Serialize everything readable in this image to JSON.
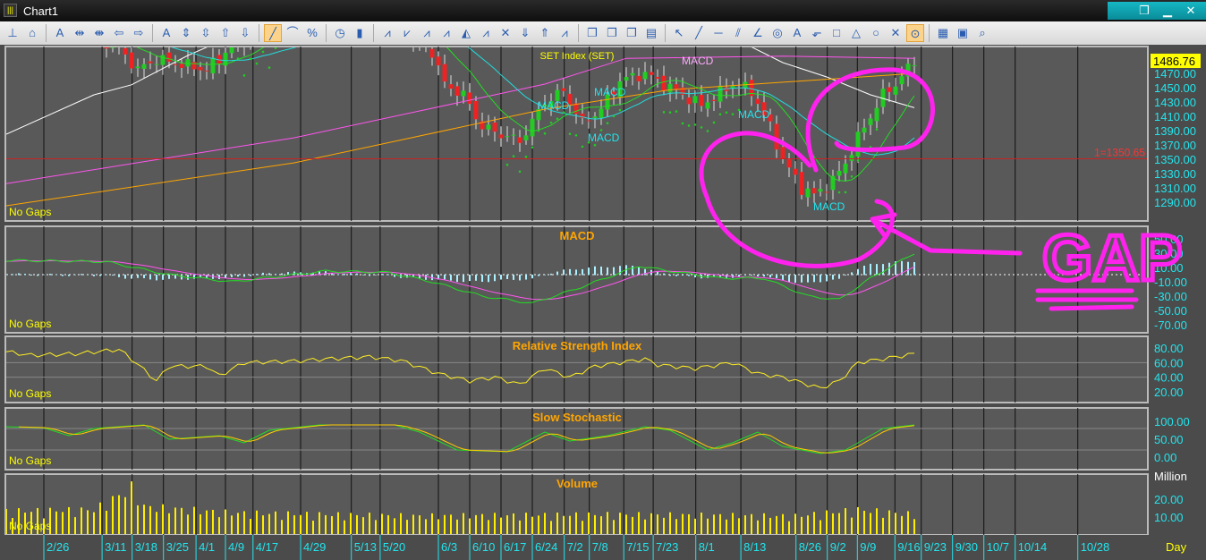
{
  "window": {
    "title": "Chart1",
    "icon": "chart-app-icon",
    "buttons": [
      "restore-icon",
      "minimize-icon",
      "close-icon"
    ]
  },
  "toolbar": {
    "icons": [
      "pin-icon",
      "home-icon",
      "text-axis-icon",
      "expand-horizontal-icon",
      "compress-horizontal-icon",
      "arrow-left-icon",
      "arrow-right-icon",
      "vertical-text-icon",
      "expand-vertical-icon",
      "compress-vertical-icon",
      "arrow-up-icon",
      "arrow-down-icon",
      "linear-scale-icon",
      "log-scale-icon",
      "percent-icon",
      "timer-icon",
      "candlestick-icon",
      "add-indicator-icon",
      "add-study-icon",
      "add-overlay-icon",
      "add-panel-icon",
      "paint-icon",
      "remove-indicator-icon",
      "delete-icon",
      "move-down-icon",
      "move-up-icon",
      "remove-panel-icon",
      "copy-icon",
      "paste-icon",
      "duplicate-icon",
      "clipboard-icon",
      "cursor-icon",
      "line-icon",
      "horizontal-line-icon",
      "parallel-lines-icon",
      "fan-icon",
      "circle-tool-icon",
      "text-tool-icon",
      "callout-icon",
      "rectangle-icon",
      "triangle-icon",
      "ellipse-icon",
      "delete-drawing-icon",
      "magnet-icon",
      "grid-icon",
      "properties-icon",
      "print-preview-icon"
    ],
    "glyphs": [
      "⊥",
      "⌂",
      "A",
      "⇹",
      "⇼",
      "⇦",
      "⇨",
      "A",
      "⇕",
      "⇳",
      "⇧",
      "⇩",
      "╱",
      "⌒",
      "%",
      "◷",
      "▮",
      "⩘",
      "⩗",
      "⩘",
      "⩘",
      "◭",
      "⩘",
      "✕",
      "⇓",
      "⇑",
      "⩘",
      "❐",
      "❐",
      "❐",
      "▤",
      "↖",
      "╱",
      "─",
      "⫽",
      "∠",
      "◎",
      "A",
      "⬐",
      "□",
      "△",
      "○",
      "✕",
      "⊙",
      "▦",
      "▣",
      "⌕"
    ]
  },
  "panels": {
    "price": {
      "title": "SET Index (SET)",
      "no_gaps": "No Gaps",
      "last_price": "1486.76",
      "axis": [
        "1470.00",
        "1450.00",
        "1430.00",
        "1410.00",
        "1390.00",
        "1370.00",
        "1350.00",
        "1330.00",
        "1310.00",
        "1290.00"
      ],
      "hline_label": "1=1350.65",
      "hline_value": 1350.65,
      "signal_label": "MACD"
    },
    "macd": {
      "title": "MACD",
      "no_gaps": "No Gaps",
      "axis": [
        "50.00",
        "30.00",
        "10.00",
        "-10.00",
        "-30.00",
        "-50.00",
        "-70.00"
      ]
    },
    "rsi": {
      "title": "Relative Strength Index",
      "no_gaps": "No Gaps",
      "axis": [
        "80.00",
        "60.00",
        "40.00",
        "20.00"
      ]
    },
    "stoch": {
      "title": "Slow Stochastic",
      "no_gaps": "No Gaps",
      "axis": [
        "100.00",
        "50.00",
        "0.00"
      ]
    },
    "volume": {
      "title": "Volume",
      "no_gaps": "No Gaps",
      "axis": [
        "Million",
        "20.00",
        "10.00"
      ]
    }
  },
  "annotation": {
    "text": "GAP",
    "color": "#ff22ee"
  },
  "date_axis": {
    "unit_label": "Day",
    "labels": [
      [
        "2/26",
        0
      ],
      [
        "3/11",
        9.3
      ],
      [
        "3/18",
        14.1
      ],
      [
        "3/25",
        19.1
      ],
      [
        "4/1",
        24.3
      ],
      [
        "4/9",
        29
      ],
      [
        "4/17",
        33.4
      ],
      [
        "4/29",
        41
      ],
      [
        "5/13",
        49.1
      ],
      [
        "5/20",
        53.7
      ],
      [
        "6/3",
        63
      ],
      [
        "6/10",
        68
      ],
      [
        "6/17",
        73
      ],
      [
        "6/24",
        78
      ],
      [
        "7/2",
        83.1
      ],
      [
        "7/8",
        87.1
      ],
      [
        "7/15",
        92.6
      ],
      [
        "7/23",
        97.3
      ],
      [
        "8/1",
        104.1
      ],
      [
        "8/13",
        111.3
      ],
      [
        "8/26",
        120.1
      ],
      [
        "9/2",
        125.1
      ],
      [
        "9/9",
        129.9
      ],
      [
        "9/16",
        135.9
      ],
      [
        "9/23",
        140.1
      ],
      [
        "9/30",
        145.1
      ],
      [
        "10/7",
        150.1
      ],
      [
        "10/14",
        155.1
      ],
      [
        "10/28",
        165.1
      ]
    ]
  },
  "colors": {
    "bg": "#4b4b4b",
    "up": "#22cc22",
    "down": "#ee2222",
    "axis_text": "#22e5ee",
    "title": "#ffa500",
    "no_gaps": "#ffff00"
  },
  "chart_data": {
    "type": "candlestick+indicators",
    "x_unit": "trading day index (0 = 2/26)",
    "price_close_keypoints": [
      [
        -6,
        1540
      ],
      [
        5,
        1530
      ],
      [
        12,
        1505
      ],
      [
        15,
        1475
      ],
      [
        18,
        1490
      ],
      [
        26,
        1475
      ],
      [
        28,
        1490
      ],
      [
        30,
        1510
      ],
      [
        40,
        1540
      ],
      [
        55,
        1540
      ],
      [
        62,
        1500
      ],
      [
        64,
        1455
      ],
      [
        67,
        1440
      ],
      [
        70,
        1395
      ],
      [
        76,
        1375
      ],
      [
        80,
        1430
      ],
      [
        83,
        1445
      ],
      [
        86,
        1400
      ],
      [
        89,
        1420
      ],
      [
        92,
        1460
      ],
      [
        96,
        1470
      ],
      [
        99,
        1455
      ],
      [
        102,
        1440
      ],
      [
        105,
        1425
      ],
      [
        110,
        1455
      ],
      [
        113,
        1445
      ],
      [
        116,
        1395
      ],
      [
        118,
        1350
      ],
      [
        121,
        1310
      ],
      [
        123,
        1300
      ],
      [
        126,
        1320
      ],
      [
        128,
        1345
      ],
      [
        130,
        1380
      ],
      [
        132,
        1410
      ],
      [
        134,
        1440
      ],
      [
        136,
        1455
      ],
      [
        139,
        1487
      ]
    ],
    "ma_white": [
      [
        -6,
        1385
      ],
      [
        8,
        1440
      ],
      [
        14,
        1454
      ],
      [
        23,
        1495
      ],
      [
        40,
        1560
      ],
      [
        110,
        1520
      ],
      [
        118,
        1485
      ],
      [
        125,
        1465
      ],
      [
        132,
        1440
      ],
      [
        139,
        1422
      ]
    ],
    "ma_pink": [
      [
        -6,
        1316
      ],
      [
        40,
        1380
      ],
      [
        80,
        1455
      ],
      [
        93,
        1491
      ],
      [
        118,
        1494
      ],
      [
        139,
        1491
      ]
    ],
    "ma_orange": [
      [
        -6,
        1285
      ],
      [
        40,
        1345
      ],
      [
        80,
        1420
      ],
      [
        100,
        1447
      ],
      [
        139,
        1470
      ]
    ],
    "macd_keypoints": [
      [
        -6,
        20
      ],
      [
        10,
        18
      ],
      [
        20,
        0
      ],
      [
        30,
        -10
      ],
      [
        45,
        5
      ],
      [
        55,
        3
      ],
      [
        62,
        -10
      ],
      [
        70,
        -30
      ],
      [
        78,
        -40
      ],
      [
        85,
        -20
      ],
      [
        95,
        12
      ],
      [
        100,
        5
      ],
      [
        108,
        -5
      ],
      [
        115,
        -5
      ],
      [
        122,
        -30
      ],
      [
        127,
        -35
      ],
      [
        132,
        -5
      ],
      [
        139,
        30
      ]
    ],
    "rsi_keypoints": [
      [
        -6,
        75
      ],
      [
        -2,
        70
      ],
      [
        5,
        72
      ],
      [
        12,
        78
      ],
      [
        14,
        65
      ],
      [
        18,
        35
      ],
      [
        20,
        55
      ],
      [
        26,
        55
      ],
      [
        28,
        42
      ],
      [
        32,
        60
      ],
      [
        40,
        62
      ],
      [
        45,
        65
      ],
      [
        52,
        68
      ],
      [
        57,
        63
      ],
      [
        63,
        45
      ],
      [
        68,
        35
      ],
      [
        72,
        40
      ],
      [
        76,
        30
      ],
      [
        80,
        52
      ],
      [
        84,
        40
      ],
      [
        88,
        55
      ],
      [
        92,
        60
      ],
      [
        96,
        65
      ],
      [
        98,
        57
      ],
      [
        104,
        52
      ],
      [
        110,
        60
      ],
      [
        114,
        45
      ],
      [
        118,
        40
      ],
      [
        122,
        30
      ],
      [
        124,
        25
      ],
      [
        127,
        35
      ],
      [
        130,
        60
      ],
      [
        134,
        65
      ],
      [
        139,
        72
      ]
    ],
    "stoch_k_keypoints": [
      [
        -6,
        85
      ],
      [
        0,
        82
      ],
      [
        4,
        60
      ],
      [
        8,
        80
      ],
      [
        16,
        90
      ],
      [
        20,
        50
      ],
      [
        28,
        60
      ],
      [
        32,
        40
      ],
      [
        36,
        75
      ],
      [
        44,
        90
      ],
      [
        56,
        90
      ],
      [
        60,
        70
      ],
      [
        66,
        20
      ],
      [
        74,
        15
      ],
      [
        80,
        70
      ],
      [
        84,
        45
      ],
      [
        90,
        60
      ],
      [
        96,
        85
      ],
      [
        100,
        75
      ],
      [
        106,
        20
      ],
      [
        110,
        40
      ],
      [
        114,
        70
      ],
      [
        118,
        30
      ],
      [
        124,
        10
      ],
      [
        128,
        20
      ],
      [
        134,
        80
      ],
      [
        139,
        90
      ]
    ],
    "volume_keypoints_million": [
      [
        -6,
        15
      ],
      [
        8,
        16
      ],
      [
        12,
        25
      ],
      [
        14,
        30
      ],
      [
        16,
        18
      ],
      [
        30,
        14
      ],
      [
        60,
        12
      ],
      [
        90,
        13
      ],
      [
        120,
        12
      ],
      [
        130,
        16
      ],
      [
        139,
        13
      ]
    ]
  }
}
